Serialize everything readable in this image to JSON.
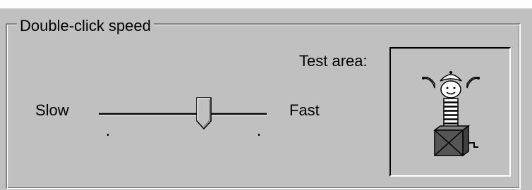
{
  "mouse_properties": {
    "double_click_group": {
      "title": "Double-click speed",
      "slow_label": "Slow",
      "fast_label": "Fast",
      "test_area_label": "Test area:",
      "speed_position_fraction": 0.64
    },
    "test_area_icon": "jack-in-the-box-icon"
  }
}
